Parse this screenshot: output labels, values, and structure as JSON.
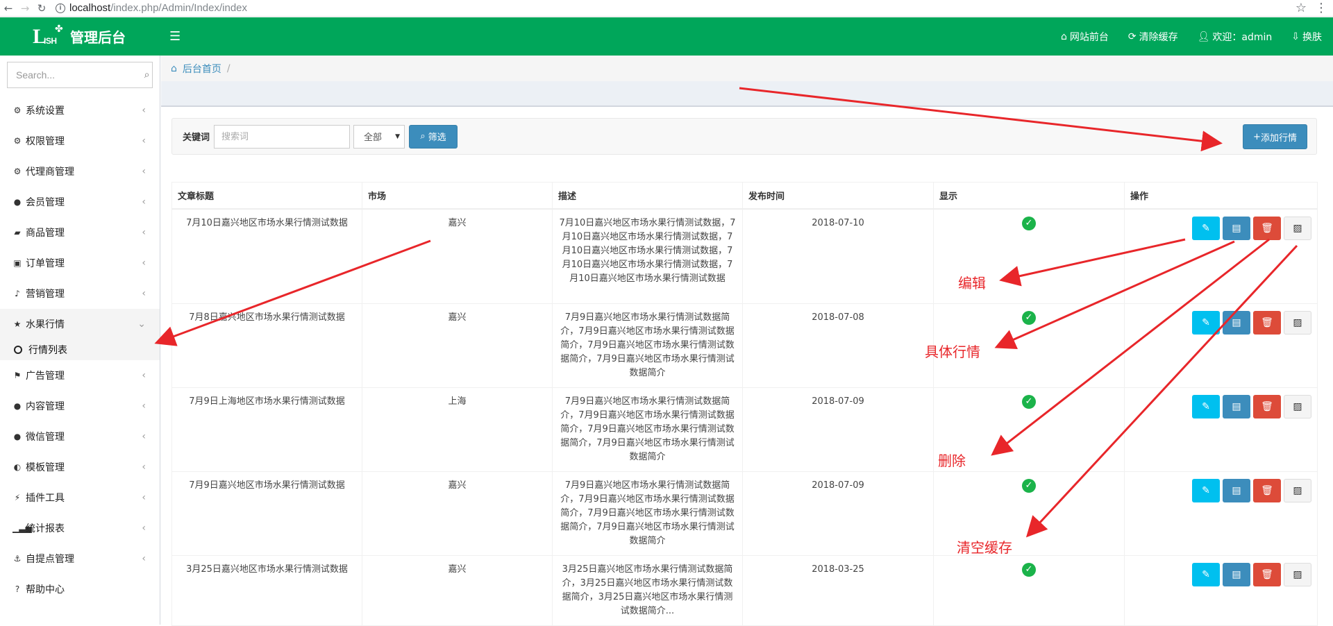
{
  "browser": {
    "url_host": "localhost",
    "url_path": "/index.php/Admin/Index/index"
  },
  "header": {
    "brand_title": "管理后台",
    "logo_big": "L",
    "logo_small": "ISH",
    "nav": [
      {
        "icon": "home-icon",
        "label": "网站前台"
      },
      {
        "icon": "refresh-icon",
        "label": "清除缓存"
      },
      {
        "icon": "user-icon",
        "label": "欢迎：admin"
      },
      {
        "icon": "skin-icon",
        "label": "换肤"
      }
    ]
  },
  "sidebar": {
    "search_placeholder": "Search...",
    "items": [
      {
        "label": "系统设置",
        "icon": "gear-icon"
      },
      {
        "label": "权限管理",
        "icon": "gears-icon"
      },
      {
        "label": "代理商管理",
        "icon": "gears-icon"
      },
      {
        "label": "会员管理",
        "icon": "user-icon"
      },
      {
        "label": "商品管理",
        "icon": "book-icon"
      },
      {
        "label": "订单管理",
        "icon": "money-icon"
      },
      {
        "label": "营销管理",
        "icon": "bell-icon"
      },
      {
        "label": "水果行情",
        "icon": "star-icon"
      },
      {
        "label": "广告管理",
        "icon": "flag-icon"
      },
      {
        "label": "内容管理",
        "icon": "comments-icon"
      },
      {
        "label": "微信管理",
        "icon": "wechat-icon"
      },
      {
        "label": "模板管理",
        "icon": "adjust-icon"
      },
      {
        "label": "插件工具",
        "icon": "plug-icon"
      },
      {
        "label": "统计报表",
        "icon": "signal-icon"
      },
      {
        "label": "自提点管理",
        "icon": "anchor-icon"
      },
      {
        "label": "帮助中心",
        "icon": "question-icon"
      }
    ],
    "submenu_label": "行情列表"
  },
  "breadcrumb": {
    "home": "后台首页",
    "sep": "/"
  },
  "filter": {
    "keyword_label": "关键词",
    "keyword_placeholder": "搜索词",
    "select_value": "全部",
    "filter_button": "筛选",
    "add_button": "添加行情"
  },
  "table": {
    "headers": [
      "文章标题",
      "市场",
      "描述",
      "发布时间",
      "显示",
      "操作"
    ],
    "rows": [
      {
        "title": "7月10日嘉兴地区市场水果行情测试数据",
        "market": "嘉兴",
        "desc": "7月10日嘉兴地区市场水果行情测试数据，7月10日嘉兴地区市场水果行情测试数据，7月10日嘉兴地区市场水果行情测试数据，7月10日嘉兴地区市场水果行情测试数据，7月10日嘉兴地区市场水果行情测试数据",
        "date": "2018-07-10"
      },
      {
        "title": "7月8日嘉兴地区市场水果行情测试数据",
        "market": "嘉兴",
        "desc": "7月9日嘉兴地区市场水果行情测试数据简介，7月9日嘉兴地区市场水果行情测试数据简介，7月9日嘉兴地区市场水果行情测试数据简介，7月9日嘉兴地区市场水果行情测试数据简介",
        "date": "2018-07-08"
      },
      {
        "title": "7月9日上海地区市场水果行情测试数据",
        "market": "上海",
        "desc": "7月9日嘉兴地区市场水果行情测试数据简介，7月9日嘉兴地区市场水果行情测试数据简介，7月9日嘉兴地区市场水果行情测试数据简介，7月9日嘉兴地区市场水果行情测试数据简介",
        "date": "2018-07-09"
      },
      {
        "title": "7月9日嘉兴地区市场水果行情测试数据",
        "market": "嘉兴",
        "desc": "7月9日嘉兴地区市场水果行情测试数据简介，7月9日嘉兴地区市场水果行情测试数据简介，7月9日嘉兴地区市场水果行情测试数据简介，7月9日嘉兴地区市场水果行情测试数据简介",
        "date": "2018-07-09"
      },
      {
        "title": "3月25日嘉兴地区市场水果行情测试数据",
        "market": "嘉兴",
        "desc": "3月25日嘉兴地区市场水果行情测试数据简介，3月25日嘉兴地区市场水果行情测试数据简介，3月25日嘉兴地区市场水果行情测试数据简介...",
        "date": "2018-03-25"
      }
    ]
  },
  "annotations": {
    "edit": "编辑",
    "detail": "具体行情",
    "delete": "删除",
    "clear_cache": "清空缓存"
  },
  "colors": {
    "header_green": "#00a65a",
    "primary_blue": "#3c8dbc",
    "edit_cyan": "#00c0ef",
    "delete_red": "#dd4b39",
    "annotation_red": "#e8262a"
  }
}
